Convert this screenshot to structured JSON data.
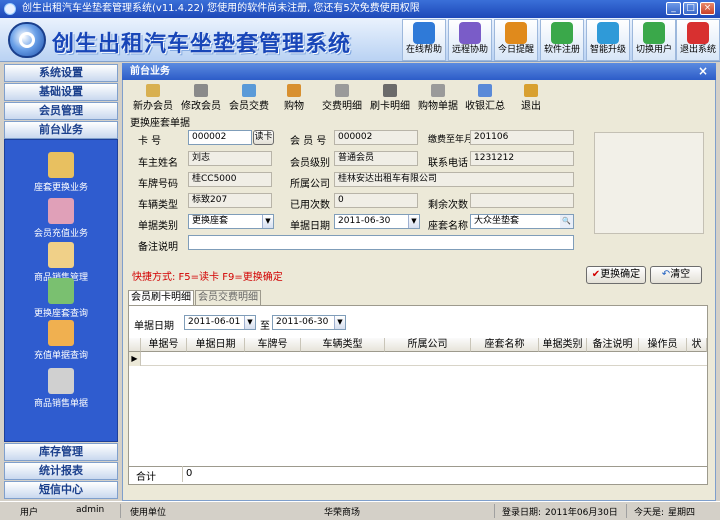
{
  "window": {
    "title": "创生出租汽车坐垫套管理系统(v11.4.22)   您使用的软件尚未注册, 您还有5次免费使用权限",
    "min": "_",
    "max": "□",
    "close": "×"
  },
  "app": {
    "title": "创生出租汽车坐垫套管理系统"
  },
  "toolbar": [
    {
      "label": "在线帮助",
      "icon": "help-icon",
      "color": "#2f7ad8"
    },
    {
      "label": "远程协助",
      "icon": "remote-icon",
      "color": "#7a5cc8"
    },
    {
      "label": "今日提醒",
      "icon": "reminder-icon",
      "color": "#e08a1c"
    },
    {
      "label": "软件注册",
      "icon": "register-icon",
      "color": "#3aa84a"
    },
    {
      "label": "智能升级",
      "icon": "upgrade-icon",
      "color": "#2f9ad8"
    },
    {
      "label": "切换用户",
      "icon": "switch-user-icon",
      "color": "#3aa84a"
    },
    {
      "label": "退出系统",
      "icon": "exit-icon",
      "color": "#d83030"
    }
  ],
  "sidebar": {
    "headers": [
      "系统设置",
      "基础设置",
      "会员管理",
      "前台业务"
    ],
    "bottom_headers": [
      "库存管理",
      "统计报表",
      "短信中心"
    ],
    "items": [
      {
        "label": "座套更换业务",
        "icon": "seat-replace-icon",
        "color": "#e8c060"
      },
      {
        "label": "会员充值业务",
        "icon": "member-recharge-icon",
        "color": "#e0a0b8"
      },
      {
        "label": "商品销售管理",
        "icon": "sales-icon",
        "color": "#f0d088"
      },
      {
        "label": "更换座套查询",
        "icon": "replace-query-icon",
        "color": "#7ac070"
      },
      {
        "label": "充值单据查询",
        "icon": "recharge-query-icon",
        "color": "#f0b050"
      },
      {
        "label": "商品销售单据",
        "icon": "sales-receipt-icon",
        "color": "#d0d0d0"
      }
    ]
  },
  "content": {
    "title": "前台业务",
    "close": "×",
    "toolbar": [
      "新办会员",
      "修改会员",
      "会员交费",
      "购物",
      "交费明细",
      "刷卡明细",
      "购物单据",
      "收银汇总",
      "退出"
    ],
    "group_title": "更换座套单据",
    "fields": {
      "card_label": "卡    号",
      "card_value": "000002",
      "read_card": "读卡",
      "member_no_label": "会 员 号",
      "member_no_value": "000002",
      "paid_until_label": "缴费至年月",
      "paid_until_value": "201106",
      "owner_label": "车主姓名",
      "owner_value": "刘志",
      "member_level_label": "会员级别",
      "member_level_value": "普通会员",
      "phone_label": "联系电话",
      "phone_value": "1231212",
      "plate_label": "车牌号码",
      "plate_value": "桂CC5000",
      "company_label": "所属公司",
      "company_value": "桂林安达出租车有限公司",
      "car_type_label": "车辆类型",
      "car_type_value": "标致207",
      "used_label": "已用次数",
      "used_value": "0",
      "remaining_label": "剩余次数",
      "remaining_value": "",
      "doc_type_label": "单据类别",
      "doc_type_value": "更换座套",
      "doc_date_label": "单据日期",
      "doc_date_value": "2011-06-30",
      "seat_name_label": "座套名称",
      "seat_name_value": "大众坐垫套",
      "remark_label": "备注说明",
      "remark_value": ""
    },
    "shortcut": "快捷方式: F5=读卡  F9=更换确定",
    "confirm_button": "更换确定",
    "clear_button": "清空",
    "tabs": [
      "会员刷卡明细",
      "会员交费明细"
    ],
    "filter": {
      "label": "单据日期",
      "from": "2011-06-01",
      "to_label": "至",
      "to": "2011-06-30"
    },
    "grid": {
      "columns": [
        "单据号",
        "单据日期",
        "车牌号",
        "车辆类型",
        "所属公司",
        "座套名称",
        "单据类别",
        "备注说明",
        "操作员",
        "状"
      ],
      "total_label": "合计",
      "total_value": "0"
    }
  },
  "statusbar": {
    "user_label": "用户",
    "user_value": "admin",
    "unit_label": "使用单位",
    "unit_value": "华荣商场",
    "login_label": "登录日期:",
    "login_value": "2011年06月30日",
    "today_label": "今天是:",
    "today_value": "星期四"
  }
}
